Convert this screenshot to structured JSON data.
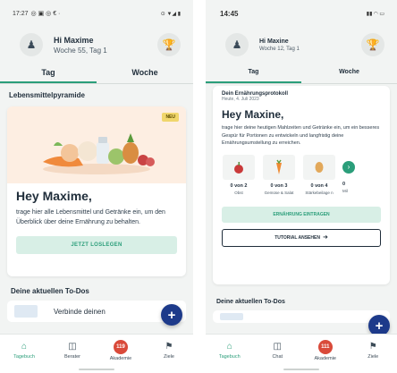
{
  "left": {
    "status": {
      "time": "17:27",
      "icons": "◎ ▣ ◎ € ·",
      "right": "⊙ ▼◢ ▮"
    },
    "header": {
      "name": "Hi Maxime",
      "week": "Woche 55, Tag 1"
    },
    "tabs": [
      "Tag",
      "Woche"
    ],
    "section_title": "Lebensmittelpyramide",
    "card": {
      "badge": "NEU",
      "greeting": "Hey Maxime,",
      "text": "trage hier alle Lebensmittel und Getränke ein, um den Überblick über deine Ernährung zu behalten.",
      "cta": "JETZT LOSLEGEN"
    },
    "todos_title": "Deine aktuellen To-Dos",
    "todo_item": "Verbinde deinen",
    "nav": [
      {
        "label": "Tagebuch"
      },
      {
        "label": "Berater"
      },
      {
        "label": "Akademie",
        "badge": "119"
      },
      {
        "label": "Ziele"
      }
    ]
  },
  "right": {
    "status": {
      "time": "14:45",
      "right": "▮▮ ◠ ▭"
    },
    "header": {
      "name": "Hi Maxine",
      "week": "Woche 12, Tag 1"
    },
    "tabs": [
      "Tag",
      "Woche"
    ],
    "section_title": "Dein Ernährungsprotokoll",
    "section_date": "Heute, 4. Juli 2023",
    "card": {
      "greeting": "Hey Maxine,",
      "text": "trage hier deine heutigen Mahlzeiten und Getränke ein, um ein besseres Gespür für Portionen zu entwickeln und langfristig deine Ernährungsumstellung zu erreichen.",
      "foods": [
        {
          "count": "0 von 2",
          "name": "Obst"
        },
        {
          "count": "0 von 3",
          "name": "Gemüse & Salat"
        },
        {
          "count": "0 von 4",
          "name": "Stärkebeilage n"
        },
        {
          "count": "0",
          "name": "Mil"
        }
      ],
      "enter_button": "ERNÄHRUNG EINTRAGEN",
      "tutorial_button": "TUTORIAL ANSEHEN"
    },
    "todos_title": "Deine aktuellen To-Dos",
    "nav": [
      {
        "label": "Tagebuch"
      },
      {
        "label": "Chat"
      },
      {
        "label": "Akademie",
        "badge": "111"
      },
      {
        "label": "Ziele"
      }
    ]
  },
  "colors": {
    "accent": "#2b9e7a",
    "fab": "#1d3a8a",
    "badge": "#d94a3a",
    "new_badge": "#f0d66c"
  }
}
